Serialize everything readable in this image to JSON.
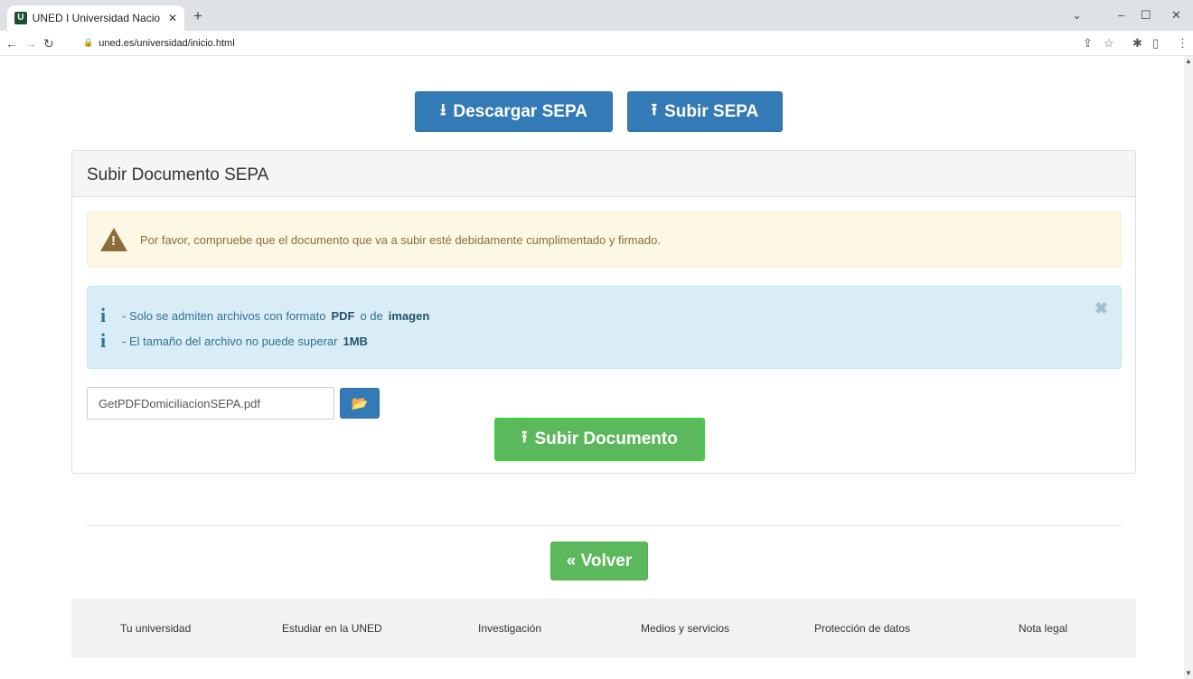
{
  "browser": {
    "tab_title": "UNED I Universidad Nacio",
    "favicon_letter": "U",
    "tab_close": "✕",
    "new_tab": "+",
    "url": "uned.es/universidad/inicio.html"
  },
  "top_buttons": {
    "download_label": "Descargar SEPA",
    "upload_label": "Subir SEPA"
  },
  "panel": {
    "title": "Subir Documento SEPA",
    "warning_text": "Por favor, compruebe que el documento que va a subir esté debidamente cumplimentado y firmado.",
    "info": {
      "line1_prefix": "- Solo se admiten archivos con formato",
      "line1_format1": "PDF",
      "line1_middle": "o de",
      "line1_format2": "imagen",
      "line2_prefix": "- El tamaño del archivo no puede superar",
      "line2_size": "1MB"
    },
    "file_name": "GetPDFDomiciliacionSEPA.pdf",
    "submit_label": "Subir Documento"
  },
  "back_label": "« Volver",
  "footer": {
    "links": [
      "Tu universidad",
      "Estudiar en la UNED",
      "Investigación",
      "Medios y servicios",
      "Protección de datos",
      "Nota legal"
    ]
  },
  "colors": {
    "primary": "#337ab7",
    "success": "#5cb85c",
    "warning_bg": "#fcf8e3",
    "info_bg": "#d9edf7"
  }
}
